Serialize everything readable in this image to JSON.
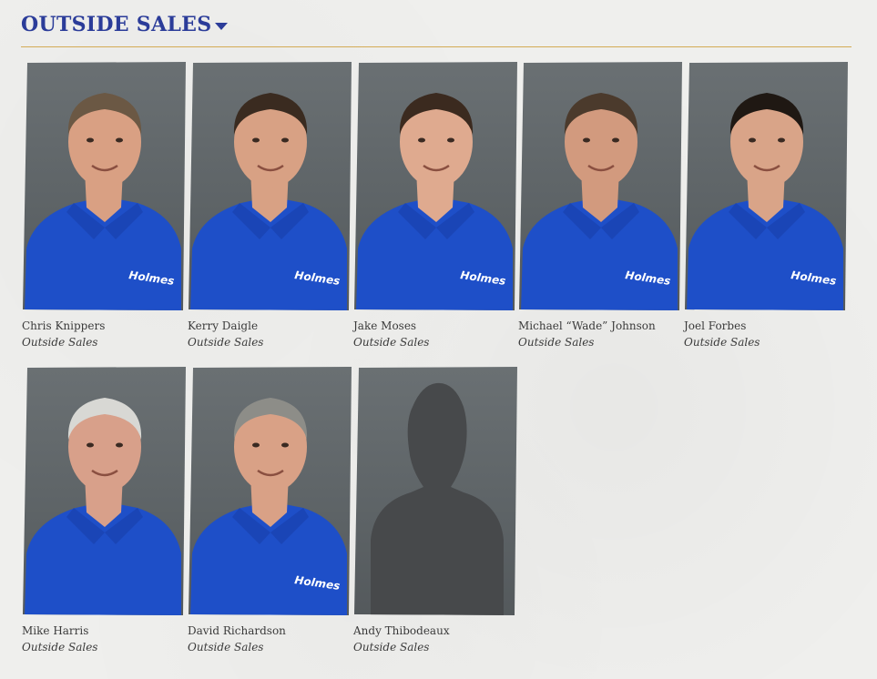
{
  "section": {
    "title": "OUTSIDE SALES",
    "accent_color": "#2b3c99",
    "divider_color": "#d4ab55",
    "toggle_icon": "caret-down-icon"
  },
  "staff": [
    {
      "name": "Chris Knippers",
      "role": "Outside Sales",
      "photo": "headshot",
      "shirt_color": "#1e4fc8",
      "shirt_logo": "Holmes",
      "hair": "#6b5844",
      "skin": "#d9a083"
    },
    {
      "name": "Kerry Daigle",
      "role": "Outside Sales",
      "photo": "headshot",
      "shirt_color": "#1e4fc8",
      "shirt_logo": "Holmes",
      "hair": "#3a2b20",
      "skin": "#d8a184"
    },
    {
      "name": "Jake Moses",
      "role": "Outside Sales",
      "photo": "headshot",
      "shirt_color": "#1e4fc8",
      "shirt_logo": "Holmes",
      "hair": "#3b2a1f",
      "skin": "#dfaa8f"
    },
    {
      "name": "Michael “Wade” Johnson",
      "role": "Outside Sales",
      "photo": "headshot",
      "shirt_color": "#1e4fc8",
      "shirt_logo": "Holmes",
      "hair": "#4b3a2c",
      "skin": "#d29a7e"
    },
    {
      "name": "Joel Forbes",
      "role": "Outside Sales",
      "photo": "headshot",
      "shirt_color": "#1e4fc8",
      "shirt_logo": "Holmes",
      "hair": "#1f1813",
      "skin": "#d9a488"
    },
    {
      "name": "Mike Harris",
      "role": "Outside Sales",
      "photo": "headshot",
      "shirt_color": "#1e4fc8",
      "shirt_logo": "",
      "hair": "#d8d8d4",
      "skin": "#d8a08a"
    },
    {
      "name": "David Richardson",
      "role": "Outside Sales",
      "photo": "headshot",
      "shirt_color": "#1e4fc8",
      "shirt_logo": "Holmes",
      "hair": "#8d8d88",
      "skin": "#d9a186"
    },
    {
      "name": "Andy Thibodeaux",
      "role": "Outside Sales",
      "photo": "placeholder-silhouette",
      "shirt_color": "#47494b",
      "shirt_logo": "",
      "hair": "#47494b",
      "skin": "#47494b"
    }
  ]
}
